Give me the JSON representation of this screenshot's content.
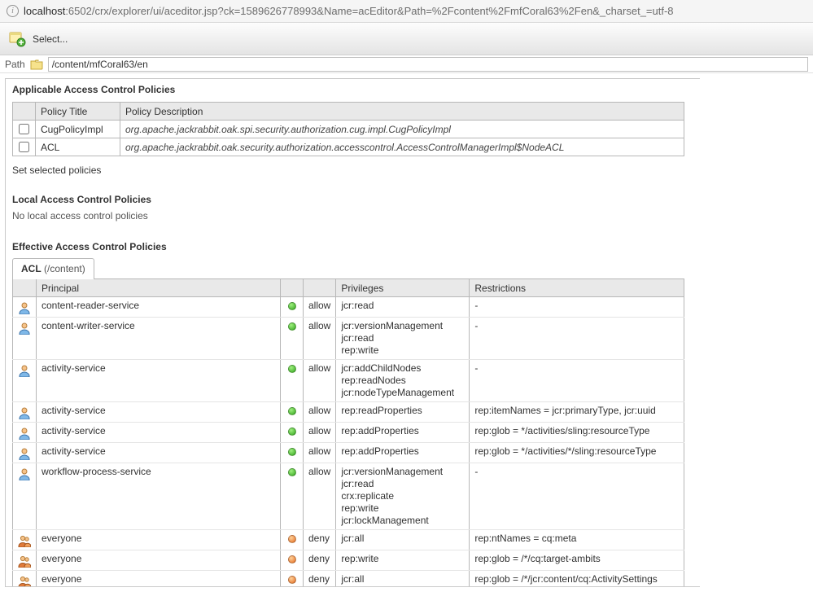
{
  "address_bar": {
    "host": "localhost",
    "rest": ":6502/crx/explorer/ui/aceditor.jsp?ck=1589626778993&Name=acEditor&Path=%2Fcontent%2FmfCoral63%2Fen&_charset_=utf-8"
  },
  "toolbar": {
    "select_label": "Select..."
  },
  "path_bar": {
    "label": "Path",
    "value": "/content/mfCoral63/en"
  },
  "applicable": {
    "heading": "Applicable Access Control Policies",
    "columns": {
      "title": "Policy Title",
      "description": "Policy Description"
    },
    "rows": [
      {
        "title": "CugPolicyImpl",
        "description": "org.apache.jackrabbit.oak.spi.security.authorization.cug.impl.CugPolicyImpl"
      },
      {
        "title": "ACL",
        "description": "org.apache.jackrabbit.oak.security.authorization.accesscontrol.AccessControlManagerImpl$NodeACL"
      }
    ],
    "action_label": "Set selected policies"
  },
  "local": {
    "heading": "Local Access Control Policies",
    "empty_text": "No local access control policies"
  },
  "effective": {
    "heading": "Effective Access Control Policies",
    "tab_label": "ACL",
    "tab_path": "(/content)",
    "columns": {
      "principal": "Principal",
      "privileges": "Privileges",
      "restrictions": "Restrictions"
    },
    "rows": [
      {
        "iconType": "user",
        "principal": "content-reader-service",
        "effect": "allow",
        "dot": "green",
        "privileges": "jcr:read",
        "restrictions": "-"
      },
      {
        "iconType": "user",
        "principal": "content-writer-service",
        "effect": "allow",
        "dot": "green",
        "privileges": "jcr:versionManagement\njcr:read\nrep:write",
        "restrictions": "-"
      },
      {
        "iconType": "user",
        "principal": "activity-service",
        "effect": "allow",
        "dot": "green",
        "privileges": "jcr:addChildNodes\nrep:readNodes\njcr:nodeTypeManagement",
        "restrictions": "-"
      },
      {
        "iconType": "user",
        "principal": "activity-service",
        "effect": "allow",
        "dot": "green",
        "privileges": "rep:readProperties",
        "restrictions": "rep:itemNames = jcr:primaryType, jcr:uuid"
      },
      {
        "iconType": "user",
        "principal": "activity-service",
        "effect": "allow",
        "dot": "green",
        "privileges": "rep:addProperties",
        "restrictions": "rep:glob = */activities/sling:resourceType"
      },
      {
        "iconType": "user",
        "principal": "activity-service",
        "effect": "allow",
        "dot": "green",
        "privileges": "rep:addProperties",
        "restrictions": "rep:glob = */activities/*/sling:resourceType"
      },
      {
        "iconType": "user",
        "principal": "workflow-process-service",
        "effect": "allow",
        "dot": "green",
        "privileges": "jcr:versionManagement\njcr:read\ncrx:replicate\nrep:write\njcr:lockManagement",
        "restrictions": "-"
      },
      {
        "iconType": "group",
        "principal": "everyone",
        "effect": "deny",
        "dot": "orange",
        "privileges": "jcr:all",
        "restrictions": "rep:ntNames = cq:meta"
      },
      {
        "iconType": "group",
        "principal": "everyone",
        "effect": "deny",
        "dot": "orange",
        "privileges": "rep:write",
        "restrictions": "rep:glob = /*/cq:target-ambits"
      },
      {
        "iconType": "group",
        "principal": "everyone",
        "effect": "deny",
        "dot": "orange",
        "privileges": "jcr:all",
        "restrictions": "rep:glob = /*/jcr:content/cq:ActivitySettings"
      }
    ]
  }
}
